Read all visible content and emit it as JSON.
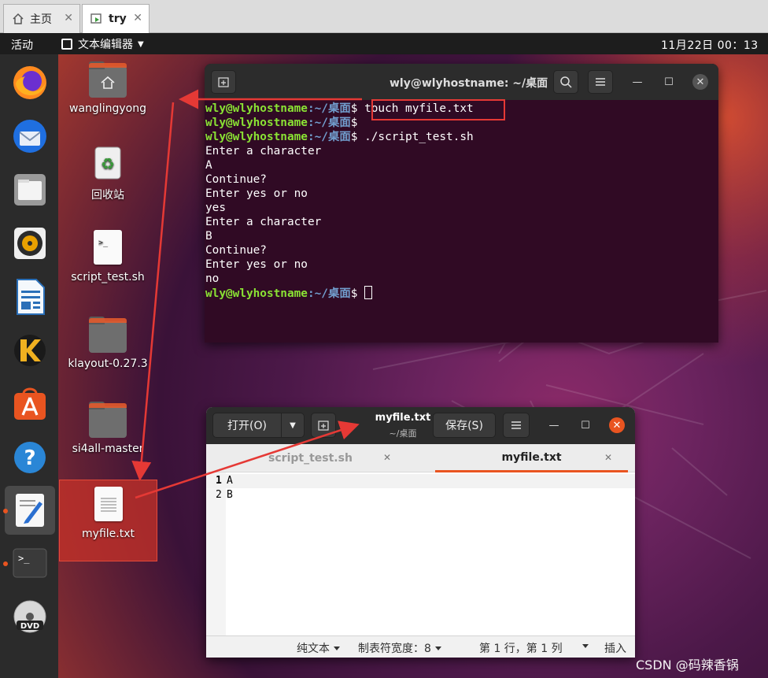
{
  "vm_tabs": [
    {
      "label": "主页",
      "icon": "home-icon"
    },
    {
      "label": "try",
      "icon": "vm-icon"
    }
  ],
  "top_panel": {
    "activities": "活动",
    "app_menu": "文本编辑器",
    "clock": "11月22日 00：13"
  },
  "dock": [
    {
      "name": "firefox-icon"
    },
    {
      "name": "thunderbird-icon"
    },
    {
      "name": "files-icon"
    },
    {
      "name": "rhythmbox-icon"
    },
    {
      "name": "libreoffice-writer-icon"
    },
    {
      "name": "klayout-icon"
    },
    {
      "name": "software-center-icon"
    },
    {
      "name": "help-icon"
    },
    {
      "name": "text-editor-icon",
      "active": true
    },
    {
      "name": "terminal-icon"
    },
    {
      "name": "dvd-icon"
    }
  ],
  "desktop_icons": [
    {
      "label": "wanglingyong",
      "type": "home-folder"
    },
    {
      "label": "回收站",
      "type": "trash"
    },
    {
      "label": "script_test.sh",
      "type": "script"
    },
    {
      "label": "klayout-0.27.3",
      "type": "folder"
    },
    {
      "label": "si4all-master",
      "type": "folder"
    },
    {
      "label": "myfile.txt",
      "type": "text"
    }
  ],
  "terminal": {
    "title": "wly@wlyhostname: ~/桌面",
    "user_host": "wly@wlyhostname",
    "path": ":~/桌面",
    "lines": [
      {
        "prompt": true,
        "cmd": "$ touch myfile.txt"
      },
      {
        "prompt": true,
        "cmd": "$"
      },
      {
        "prompt": true,
        "cmd": "$ ./script_test.sh"
      },
      {
        "prompt": false,
        "text": "Enter a character"
      },
      {
        "prompt": false,
        "text": "A"
      },
      {
        "prompt": false,
        "text": "Continue?"
      },
      {
        "prompt": false,
        "text": "Enter yes or no"
      },
      {
        "prompt": false,
        "text": "yes"
      },
      {
        "prompt": false,
        "text": "Enter a character"
      },
      {
        "prompt": false,
        "text": "B"
      },
      {
        "prompt": false,
        "text": "Continue?"
      },
      {
        "prompt": false,
        "text": "Enter yes or no"
      },
      {
        "prompt": false,
        "text": "no"
      },
      {
        "prompt": true,
        "cmd": "$ "
      }
    ]
  },
  "gedit": {
    "open_label": "打开(O)",
    "title": "myfile.txt",
    "subtitle": "~/桌面",
    "save_label": "保存(S)",
    "tabs": [
      {
        "label": "script_test.sh",
        "active": false
      },
      {
        "label": "myfile.txt",
        "active": true
      }
    ],
    "lines": [
      {
        "num": "1",
        "text": "A"
      },
      {
        "num": "2",
        "text": "B"
      }
    ],
    "status": {
      "mode": "纯文本",
      "tab_width": "制表符宽度：8",
      "position": "第 1 行，第 1 列",
      "insert": "插入"
    }
  },
  "watermark": "CSDN @码辣香锅",
  "colors": {
    "prompt_user": "#8ae234",
    "prompt_path": "#729fcf",
    "annotation_red": "#e53935",
    "ubuntu_orange": "#e95420",
    "terminal_bg": "#300a24"
  }
}
